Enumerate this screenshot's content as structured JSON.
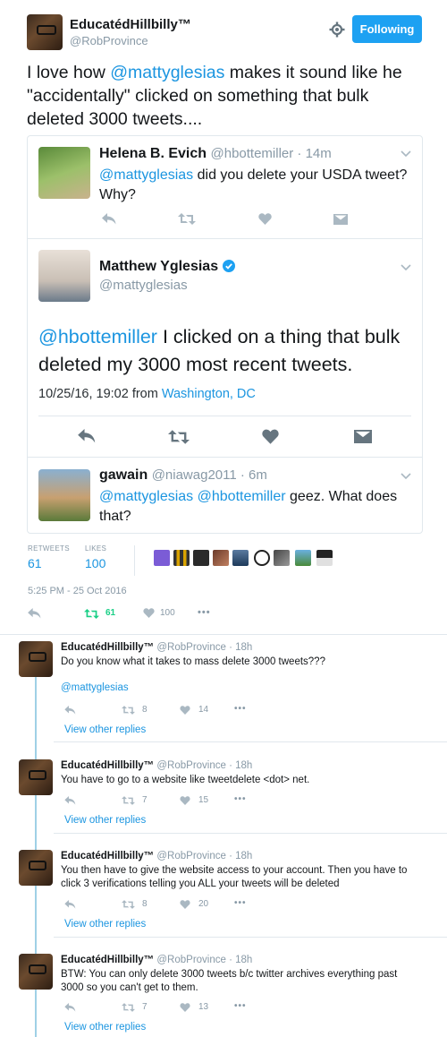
{
  "main": {
    "author_name": "EducatédHillbilly™",
    "author_handle": "@RobProvince",
    "follow_label": "Following",
    "text_prefix": "I love how ",
    "mention": "@mattyglesias",
    "text_suffix": " makes it sound like he \"accidentally\" clicked on something that bulk deleted 3000 tweets....",
    "retweets_label": "RETWEETS",
    "retweets_count": "61",
    "likes_label": "LIKES",
    "likes_count": "100",
    "timestamp": "5:25 PM - 25 Oct 2016",
    "retweet_action_count": "61",
    "like_action_count": "100",
    "more": "•••"
  },
  "quoted": {
    "helena": {
      "name": "Helena B. Evich",
      "handle_time": "@hbottemiller · 14m",
      "mention": "@mattyglesias",
      "text": " did you delete your USDA tweet? Why?"
    },
    "matt": {
      "name": "Matthew Yglesias",
      "handle": "@mattyglesias",
      "mention": "@hbottemiller",
      "text": " I clicked on a thing that bulk deleted my 3000 most recent tweets.",
      "date": "10/25/16, 19:02 from ",
      "location": "Washington, DC"
    },
    "gawain": {
      "name": "gawain",
      "handle_time": "@niawag2011 · 6m",
      "mention1": "@mattyglesias",
      "mention2": "@hbottemiller",
      "text": " geez. What does that?"
    }
  },
  "replies": [
    {
      "name": "EducatédHillbilly™",
      "handle_time": "@RobProvince · 18h",
      "text": "Do you know what it takes to mass delete 3000 tweets???",
      "extra": "@mattyglesias",
      "rt": "8",
      "likes": "14",
      "more": "•••",
      "view": "View other replies"
    },
    {
      "name": "EducatédHillbilly™",
      "handle_time": "@RobProvince · 18h",
      "text": "You have to go to a website like tweetdelete <dot> net.",
      "rt": "7",
      "likes": "15",
      "more": "•••",
      "view": "View other replies"
    },
    {
      "name": "EducatédHillbilly™",
      "handle_time": "@RobProvince · 18h",
      "text": "You then have to give the website access to your account. Then you have to click 3 verifications telling you ALL your tweets will be deleted",
      "rt": "8",
      "likes": "20",
      "more": "•••",
      "view": "View other replies"
    },
    {
      "name": "EducatédHillbilly™",
      "handle_time": "@RobProvince · 18h",
      "text": "BTW: You can only delete 3000 tweets b/c twitter archives everything past 3000 so you can't get to them.",
      "rt": "7",
      "likes": "13",
      "more": "•••",
      "view": "View other replies"
    }
  ],
  "colors": {
    "accent": "#1b95e0",
    "retweet_green": "#19cf86",
    "follow_bg": "#1da1f2"
  },
  "icons": [
    "gear-icon",
    "reply-icon",
    "retweet-icon",
    "heart-icon",
    "dm-icon",
    "chevron-down-icon",
    "verified-icon"
  ]
}
